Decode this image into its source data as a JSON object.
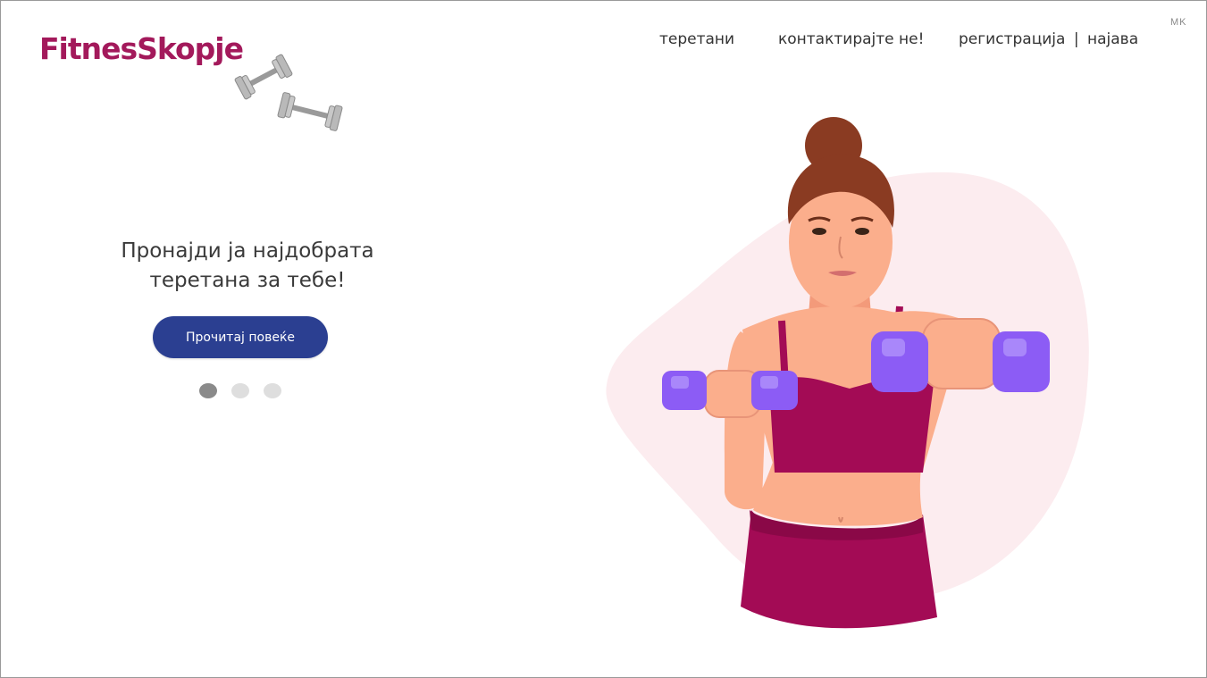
{
  "brand": {
    "logo_text": "FitnesSkopje",
    "logo_color": "#a3195b"
  },
  "header": {
    "language": "MK",
    "nav": {
      "gyms": "теретани",
      "contact": "контактирајте не!",
      "register": "регистрација",
      "separator": "|",
      "login": "најава"
    }
  },
  "hero": {
    "headline_line1": "Пронајди ја најдобрата",
    "headline_line2": "теретана за тебе!",
    "cta_label": "Прочитај повеќе",
    "cta_color": "#2b3f91",
    "slides_total": 3,
    "active_slide": 1,
    "illustration": "woman-lifting-dumbbells"
  },
  "colors": {
    "blob": "#fcecef",
    "outfit": "#a30b55",
    "dumbbell": "#8c5cf5",
    "skin": "#fbae8c"
  }
}
